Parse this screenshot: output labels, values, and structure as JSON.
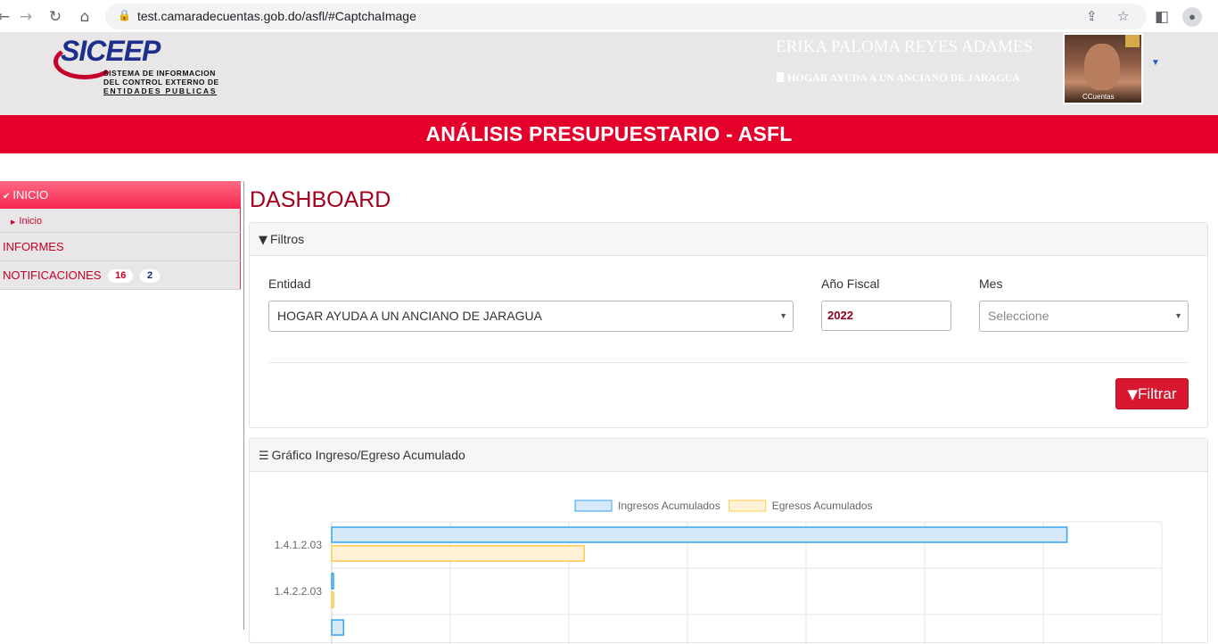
{
  "browser": {
    "url": "test.camaradecuentas.gob.do/asfl/#CaptchaImage",
    "back_icon": "back-arrow-icon",
    "forward_icon": "forward-arrow-icon",
    "reload_icon": "reload-icon",
    "home_icon": "home-icon"
  },
  "header": {
    "logo_text": "SICEEP",
    "logo_sub_1": "SISTEMA DE INFORMACION",
    "logo_sub_2": "DEL CONTROL EXTERNO DE",
    "logo_sub_3": "ENTIDADES PUBLICAS",
    "user_name": "ERIKA PALOMA REYES ADAMES",
    "user_entity": "HOGAR AYUDA A UN ANCIANO DE JARAGUA",
    "photo_tag": "CCuentas"
  },
  "title_bar": "ANÁLISIS PRESUPUESTARIO - ASFL",
  "sidebar": {
    "inicio": "INICIO",
    "inicio_sub": "Inicio",
    "informes": "INFORMES",
    "notificaciones": "NOTIFICACIONES",
    "badge_1": "16",
    "badge_2": "2"
  },
  "main": {
    "title": "DASHBOARD",
    "filters_title": "Filtros",
    "entidad_label": "Entidad",
    "entidad_value": "HOGAR AYUDA A UN ANCIANO DE JARAGUA",
    "anio_label": "Año Fiscal",
    "anio_value": "2022",
    "mes_label": "Mes",
    "mes_placeholder": "Seleccione",
    "filter_button": "Filtrar",
    "chart_title": "Gráfico Ingreso/Egreso Acumulado"
  },
  "colors": {
    "brand_red": "#e4002b",
    "ingresos_fill": "#d6e9f8",
    "ingresos_stroke": "#36a2eb",
    "egresos_fill": "#fff2d6",
    "egresos_stroke": "#ffc94a"
  },
  "chart_data": {
    "type": "bar",
    "orientation": "horizontal",
    "categories": [
      "1.4.1.2.03",
      "1.4.2.2.03",
      ""
    ],
    "series": [
      {
        "name": "Ingresos Acumulados",
        "values": [
          62,
          0.15,
          1
        ]
      },
      {
        "name": "Egresos Acumulados",
        "values": [
          21.3,
          0.15,
          null
        ]
      }
    ],
    "xlim": [
      0,
      70
    ],
    "grid": true,
    "legend": "top"
  }
}
